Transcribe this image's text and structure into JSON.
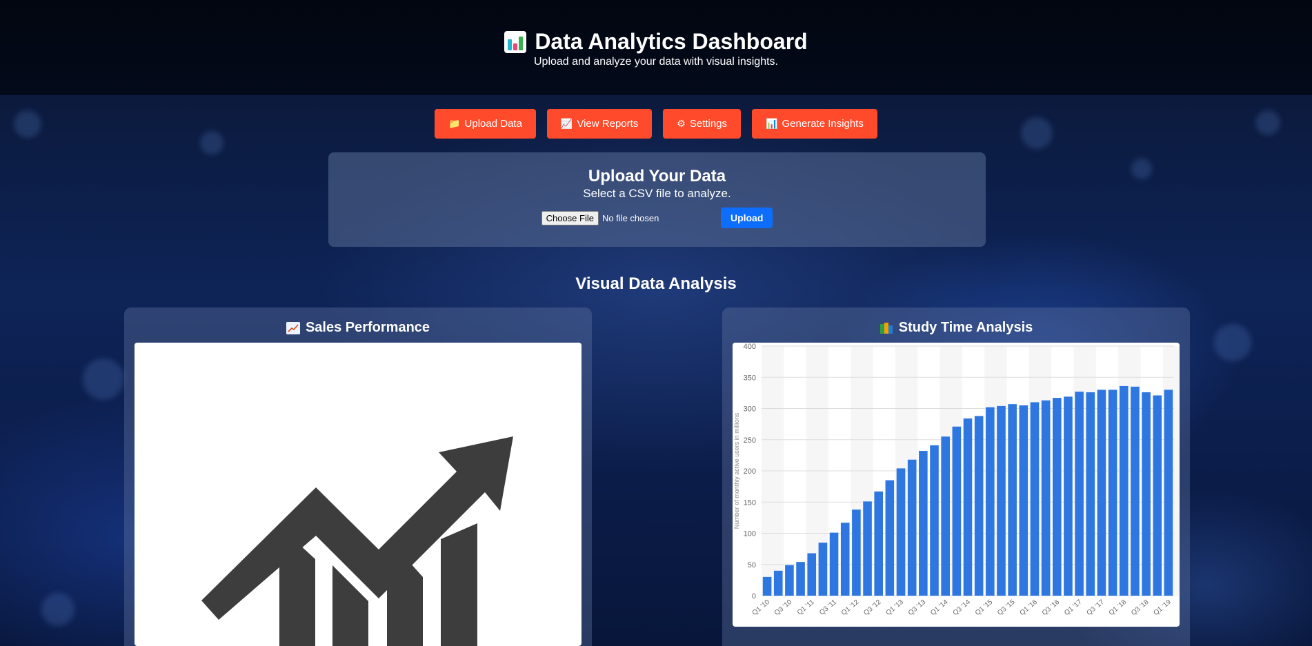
{
  "header": {
    "title": "Data Analytics Dashboard",
    "subtitle": "Upload and analyze your data with visual insights."
  },
  "actions": [
    {
      "label": "Upload Data",
      "icon": "folder-icon"
    },
    {
      "label": "View Reports",
      "icon": "chart-increasing-icon"
    },
    {
      "label": "Settings",
      "icon": "gear-icon"
    },
    {
      "label": "Generate Insights",
      "icon": "bar-chart-icon"
    }
  ],
  "upload": {
    "title": "Upload Your Data",
    "description": "Select a CSV file to analyze.",
    "choose_file_label": "Choose File",
    "file_status": "No file chosen",
    "upload_label": "Upload"
  },
  "section_title": "Visual Data Analysis",
  "panels": {
    "sales": {
      "title": "Sales Performance",
      "icon": "chart-increasing-icon"
    },
    "study": {
      "title": "Study Time Analysis",
      "icon": "books-icon"
    }
  },
  "colors": {
    "accent_button": "#ff4b2b",
    "primary_button": "#0d6efd",
    "bar": "#2f77e0",
    "growth_icon": "#3d3d3d"
  },
  "chart_data": {
    "type": "bar",
    "title": "",
    "xlabel": "",
    "ylabel": "Number of monthly active users in millions",
    "ylim": [
      0,
      400
    ],
    "yticks": [
      0,
      50,
      100,
      150,
      200,
      250,
      300,
      350,
      400
    ],
    "grid": true,
    "categories": [
      "Q1 '10",
      "Q2 '10",
      "Q3 '10",
      "Q4 '10",
      "Q1 '11",
      "Q2 '11",
      "Q3 '11",
      "Q4 '11",
      "Q1 '12",
      "Q2 '12",
      "Q3 '12",
      "Q4 '12",
      "Q1 '13",
      "Q2 '13",
      "Q3 '13",
      "Q4 '13",
      "Q1 '14",
      "Q2 '14",
      "Q3 '14",
      "Q4 '14",
      "Q1 '15",
      "Q2 '15",
      "Q3 '15",
      "Q4 '15",
      "Q1 '16",
      "Q2 '16",
      "Q3 '16",
      "Q4 '16",
      "Q1 '17",
      "Q2 '17",
      "Q3 '17",
      "Q4 '17",
      "Q1 '18",
      "Q2 '18",
      "Q3 '18",
      "Q4 '18",
      "Q1 '19"
    ],
    "tick_labels": [
      "Q1 '10",
      "Q3 '10",
      "Q1 '11",
      "Q3 '11",
      "Q1 '12",
      "Q3 '12",
      "Q1 '13",
      "Q3 '13",
      "Q1 '14",
      "Q3 '14",
      "Q1 '15",
      "Q3 '15",
      "Q1 '16",
      "Q3 '16",
      "Q1 '17",
      "Q3 '17",
      "Q1 '18",
      "Q3 '18",
      "Q1 '19"
    ],
    "values": [
      30,
      40,
      49,
      54,
      68,
      85,
      101,
      117,
      138,
      151,
      167,
      185,
      204,
      218,
      232,
      241,
      255,
      271,
      284,
      288,
      302,
      304,
      307,
      305,
      310,
      313,
      317,
      319,
      327,
      326,
      330,
      330,
      336,
      335,
      326,
      321,
      330
    ]
  }
}
